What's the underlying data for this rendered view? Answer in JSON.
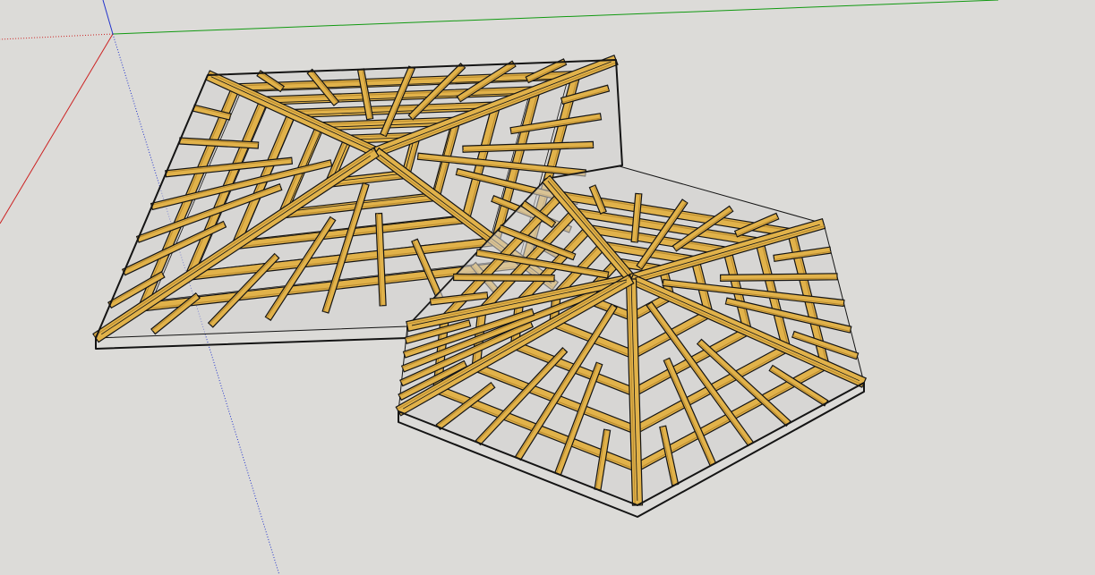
{
  "app": {
    "background_color": "#dcdbd8",
    "axis_colors": {
      "red": "#cc2222",
      "green": "#119911",
      "blue": "#2233cc"
    },
    "model": {
      "name": "roof-framing-model",
      "lumber_color": "#e1b24a",
      "lumber_shadow": "#b98a2e",
      "edge_color": "#141414",
      "glass_color": "#d3d2d1"
    }
  }
}
